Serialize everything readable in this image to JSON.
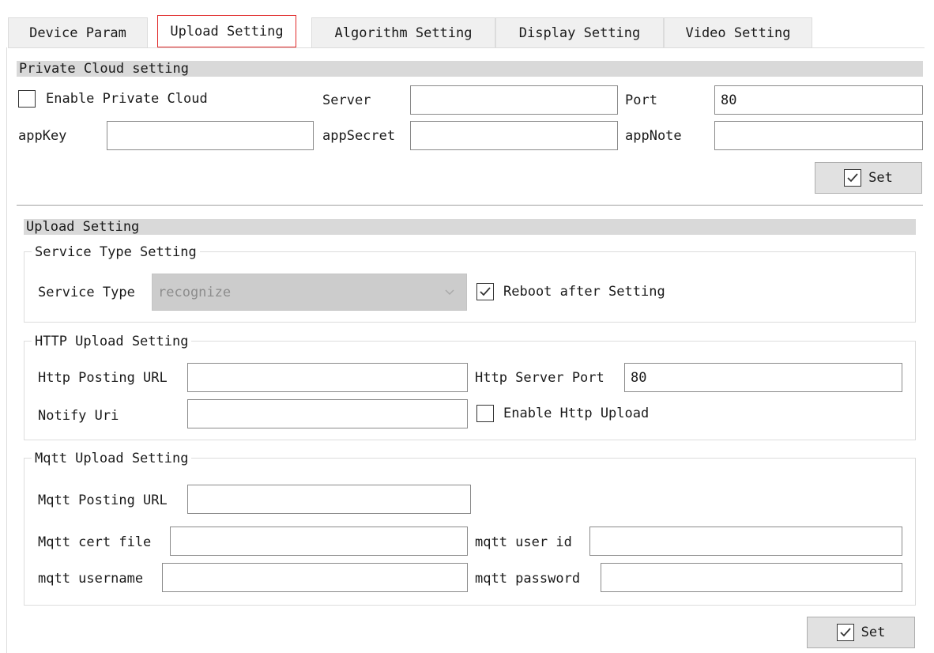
{
  "tabs": [
    {
      "label": "Device Param",
      "active": false
    },
    {
      "label": "Upload Setting",
      "active": true
    },
    {
      "label": "Algorithm Setting",
      "active": false
    },
    {
      "label": "Display Setting",
      "active": false
    },
    {
      "label": "Video Setting",
      "active": false
    }
  ],
  "private_cloud": {
    "section_title": "Private Cloud setting",
    "enable_label": "Enable Private Cloud",
    "enable_checked": false,
    "server_label": "Server",
    "server_value": "",
    "port_label": "Port",
    "port_value": "80",
    "appkey_label": "appKey",
    "appkey_value": "",
    "appsecret_label": "appSecret",
    "appsecret_value": "",
    "appnote_label": "appNote",
    "appnote_value": "",
    "set_label": "Set"
  },
  "upload": {
    "section_title": "Upload Setting",
    "service_group_title": "Service Type Setting",
    "service_type_label": "Service Type",
    "service_type_value": "recognize",
    "reboot_label": "Reboot after Setting",
    "reboot_checked": true,
    "http_group_title": "HTTP Upload Setting",
    "http_url_label": "Http Posting URL",
    "http_url_value": "",
    "http_port_label": "Http Server Port",
    "http_port_value": "80",
    "notify_uri_label": "Notify Uri",
    "notify_uri_value": "",
    "enable_http_label": "Enable Http Upload",
    "enable_http_checked": false,
    "mqtt_group_title": "Mqtt Upload Setting",
    "mqtt_url_label": "Mqtt Posting URL",
    "mqtt_url_value": "",
    "mqtt_cert_label": "Mqtt cert file",
    "mqtt_cert_value": "",
    "mqtt_userid_label": "mqtt user id",
    "mqtt_userid_value": "",
    "mqtt_username_label": "mqtt username",
    "mqtt_username_value": "",
    "mqtt_password_label": "mqtt password",
    "mqtt_password_value": "",
    "set_label": "Set"
  },
  "icons": {
    "check": "checkmark-icon",
    "dropdown": "chevron-down-icon"
  }
}
